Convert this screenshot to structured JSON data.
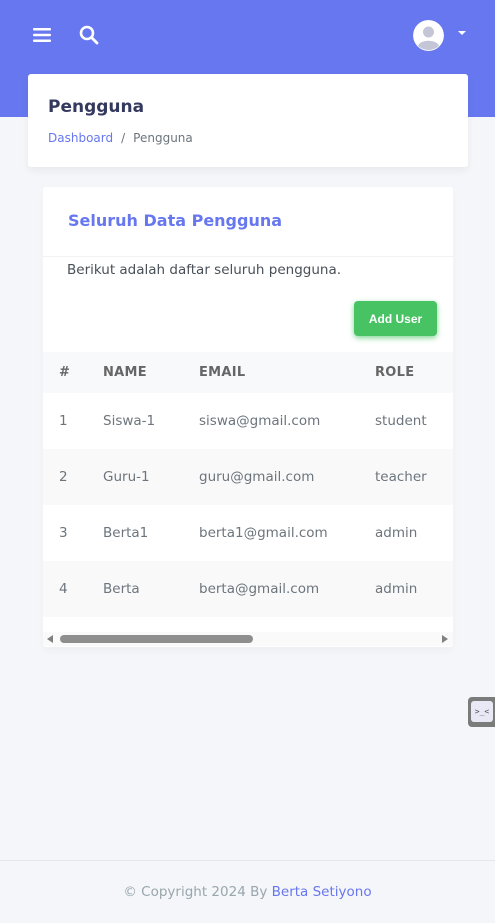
{
  "colors": {
    "primary": "#6777ef",
    "success": "#47c363",
    "background": "#f4f6f9",
    "heading": "#34395e"
  },
  "navbar": {
    "menu_icon": "hamburger-icon",
    "search_icon": "search-icon",
    "user_icon": "user-avatar-icon",
    "dropdown_icon": "caret-down-icon"
  },
  "header": {
    "title": "Pengguna",
    "breadcrumb": [
      {
        "label": "Dashboard"
      },
      {
        "label": "Pengguna"
      }
    ],
    "separator": "/"
  },
  "card": {
    "title": "Seluruh Data Pengguna",
    "description": "Berikut adalah daftar seluruh pengguna.",
    "add_button": "Add User",
    "table": {
      "columns": [
        "#",
        "NAME",
        "EMAIL",
        "ROLE"
      ],
      "rows": [
        [
          "1",
          "Siswa-1",
          "siswa@gmail.com",
          "student"
        ],
        [
          "2",
          "Guru-1",
          "guru@gmail.com",
          "teacher"
        ],
        [
          "3",
          "Berta1",
          "berta1@gmail.com",
          "admin"
        ],
        [
          "4",
          "Berta",
          "berta@gmail.com",
          "admin"
        ]
      ]
    }
  },
  "side_widget": {
    "icon": "terminal-face-icon",
    "glyph": ">_<"
  },
  "footer": {
    "prefix": "© Copyright 2024 By ",
    "author": "Berta Setiyono"
  }
}
